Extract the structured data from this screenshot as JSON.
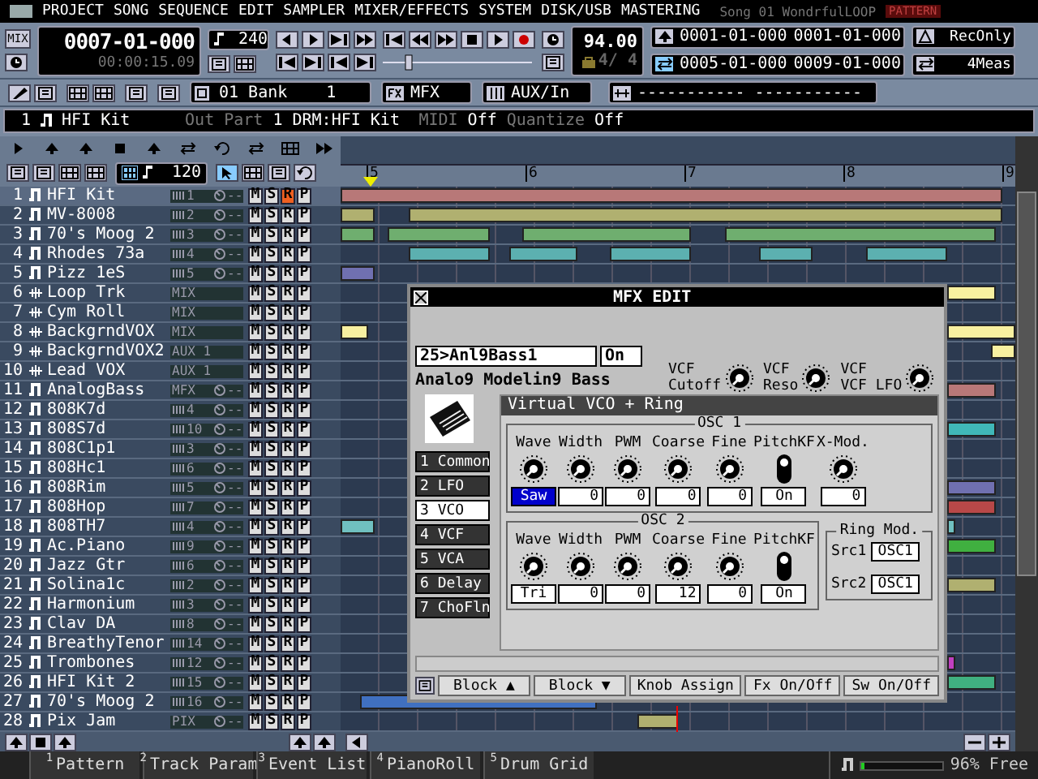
{
  "menu": {
    "items": [
      "PROJECT",
      "SONG",
      "SEQUENCE",
      "EDIT",
      "SAMPLER",
      "MIXER/EFFECTS",
      "SYSTEM",
      "DISK/USB",
      "MASTERING"
    ],
    "song_title": "Song 01 WondrfulLOOP",
    "mode_badge": "PATTERN"
  },
  "transport": {
    "mix_button": "MIX",
    "position": "0007-01-000",
    "time": "00:00:15.09",
    "step": "240",
    "tempo": "94.00",
    "meter": "4/ 4",
    "locate": [
      "0001-01-000",
      "0001-01-000"
    ],
    "loop": [
      "0005-01-000",
      "0009-01-000"
    ],
    "rec_mode": "RecOnly",
    "loop_length": "4Meas"
  },
  "mixer_row": {
    "bank": "01 Bank",
    "bank_number": "1",
    "mfx": "MFX",
    "aux": "AUX/In",
    "marker": "----------- -----------"
  },
  "info": {
    "track": "1",
    "part": "HFI Kit",
    "out_label": "Out Part",
    "out_value": "1 DRM:HFI Kit",
    "midi_label": "MIDI",
    "midi_value": "Off",
    "quantize_label": "Quantize",
    "quantize_value": "Off"
  },
  "toolbar": {
    "resolution": "120"
  },
  "ruler": {
    "bars": [
      "5",
      "6",
      "7",
      "8",
      "9"
    ]
  },
  "tracks": [
    {
      "number": "1",
      "kind": "midi",
      "name": "HFI Kit",
      "output": "1",
      "port": true,
      "pan": "--",
      "mute": "M",
      "solo": "S",
      "rec": "R",
      "play": "P",
      "record": true,
      "selected": true,
      "color": "#b87878"
    },
    {
      "number": "2",
      "kind": "midi",
      "name": "MV-8008",
      "output": "2",
      "port": true,
      "pan": "--",
      "mute": "M",
      "solo": "S",
      "rec": "R",
      "play": "P",
      "record": false,
      "selected": false,
      "color": "#b0b070"
    },
    {
      "number": "3",
      "kind": "midi",
      "name": "70's Moog 2",
      "output": "3",
      "port": true,
      "pan": "--",
      "mute": "M",
      "solo": "S",
      "rec": "R",
      "play": "P",
      "record": false,
      "selected": false,
      "color": "#6fae6f"
    },
    {
      "number": "4",
      "kind": "midi",
      "name": "Rhodes 73a",
      "output": "4",
      "port": true,
      "pan": "--",
      "mute": "M",
      "solo": "S",
      "rec": "R",
      "play": "P",
      "record": false,
      "selected": false,
      "color": "#5cb0b0"
    },
    {
      "number": "5",
      "kind": "midi",
      "name": "Pizz 1eS",
      "output": "5",
      "port": true,
      "pan": "--",
      "mute": "M",
      "solo": "S",
      "rec": "R",
      "play": "P",
      "record": false,
      "selected": false,
      "color": "#7070b0"
    },
    {
      "number": "6",
      "kind": "audio",
      "name": "Loop Trk",
      "output": "MIX",
      "port": false,
      "mute": "M",
      "solo": "S",
      "rec": "R",
      "play": "P",
      "record": false,
      "selected": false,
      "color": "#f8f0a0"
    },
    {
      "number": "7",
      "kind": "audio",
      "name": "Cym Roll",
      "output": "MIX",
      "port": false,
      "mute": "M",
      "solo": "S",
      "rec": "R",
      "play": "P",
      "record": false,
      "selected": false
    },
    {
      "number": "8",
      "kind": "audio",
      "name": "BackgrndVOX",
      "output": "MIX",
      "port": false,
      "mute": "M",
      "solo": "S",
      "rec": "R",
      "play": "P",
      "record": false,
      "selected": false,
      "color": "#f8f0a0"
    },
    {
      "number": "9",
      "kind": "audio",
      "name": "BackgrndVOX2",
      "output": "AUX 1",
      "port": false,
      "mute": "M",
      "solo": "S",
      "rec": "R",
      "play": "P",
      "record": false,
      "selected": false,
      "color": "#f8f0a0"
    },
    {
      "number": "10",
      "kind": "audio",
      "name": "Lead VOX",
      "output": "AUX 1",
      "port": false,
      "mute": "M",
      "solo": "S",
      "rec": "R",
      "play": "P",
      "record": false,
      "selected": false
    },
    {
      "number": "11",
      "kind": "midi",
      "name": "AnalogBass",
      "output": "MFX",
      "port": false,
      "pan": "--",
      "mute": "M",
      "solo": "S",
      "rec": "R",
      "play": "P",
      "record": false,
      "selected": false,
      "color": "#b87878"
    },
    {
      "number": "12",
      "kind": "midi",
      "name": "808K7d",
      "output": "4",
      "port": true,
      "pan": "--",
      "mute": "M",
      "solo": "S",
      "rec": "R",
      "play": "P",
      "record": false,
      "selected": false
    },
    {
      "number": "13",
      "kind": "midi",
      "name": "808S7d",
      "output": "10",
      "port": true,
      "pan": "--",
      "mute": "M",
      "solo": "S",
      "rec": "R",
      "play": "P",
      "record": false,
      "selected": false,
      "color": "#40b8b8"
    },
    {
      "number": "14",
      "kind": "midi",
      "name": "808C1p1",
      "output": "3",
      "port": true,
      "pan": "--",
      "mute": "M",
      "solo": "S",
      "rec": "R",
      "play": "P",
      "record": false,
      "selected": false
    },
    {
      "number": "15",
      "kind": "midi",
      "name": "808Hc1",
      "output": "6",
      "port": true,
      "pan": "--",
      "mute": "M",
      "solo": "S",
      "rec": "R",
      "play": "P",
      "record": false,
      "selected": false
    },
    {
      "number": "16",
      "kind": "midi",
      "name": "808Rim",
      "output": "5",
      "port": true,
      "pan": "--",
      "mute": "M",
      "solo": "S",
      "rec": "R",
      "play": "P",
      "record": false,
      "selected": false,
      "color": "#7070b0"
    },
    {
      "number": "17",
      "kind": "midi",
      "name": "808Hop",
      "output": "7",
      "port": true,
      "pan": "--",
      "mute": "M",
      "solo": "S",
      "rec": "R",
      "play": "P",
      "record": false,
      "selected": false,
      "color": "#b84848"
    },
    {
      "number": "18",
      "kind": "midi",
      "name": "808TH7",
      "output": "4",
      "port": true,
      "pan": "--",
      "mute": "M",
      "solo": "S",
      "rec": "R",
      "play": "P",
      "record": false,
      "selected": false,
      "color": "#70c0c0"
    },
    {
      "number": "19",
      "kind": "midi",
      "name": "Ac.Piano",
      "output": "9",
      "port": true,
      "pan": "--",
      "mute": "M",
      "solo": "S",
      "rec": "R",
      "play": "P",
      "record": false,
      "selected": false,
      "color": "#40b040"
    },
    {
      "number": "20",
      "kind": "midi",
      "name": "Jazz Gtr",
      "output": "6",
      "port": true,
      "pan": "--",
      "mute": "M",
      "solo": "S",
      "rec": "R",
      "play": "P",
      "record": false,
      "selected": false
    },
    {
      "number": "21",
      "kind": "midi",
      "name": "Solina1c",
      "output": "2",
      "port": true,
      "pan": "--",
      "mute": "M",
      "solo": "S",
      "rec": "R",
      "play": "P",
      "record": false,
      "selected": false,
      "color": "#b0b070"
    },
    {
      "number": "22",
      "kind": "midi",
      "name": "Harmonium",
      "output": "3",
      "port": true,
      "pan": "--",
      "mute": "M",
      "solo": "S",
      "rec": "R",
      "play": "P",
      "record": false,
      "selected": false
    },
    {
      "number": "23",
      "kind": "midi",
      "name": "Clav DA",
      "output": "8",
      "port": true,
      "pan": "--",
      "mute": "M",
      "solo": "S",
      "rec": "R",
      "play": "P",
      "record": false,
      "selected": false
    },
    {
      "number": "24",
      "kind": "midi",
      "name": "BreathyTenor",
      "output": "14",
      "port": true,
      "pan": "--",
      "mute": "M",
      "solo": "S",
      "rec": "R",
      "play": "P",
      "record": false,
      "selected": false
    },
    {
      "number": "25",
      "kind": "midi",
      "name": "Trombones",
      "output": "12",
      "port": true,
      "pan": "--",
      "mute": "M",
      "solo": "S",
      "rec": "R",
      "play": "P",
      "record": false,
      "selected": false,
      "color": "#c040c0"
    },
    {
      "number": "26",
      "kind": "midi",
      "name": "HFI Kit 2",
      "output": "15",
      "port": true,
      "pan": "--",
      "mute": "M",
      "solo": "S",
      "rec": "R",
      "play": "P",
      "record": false,
      "selected": false,
      "color": "#40b080"
    },
    {
      "number": "27",
      "kind": "midi",
      "name": "70's Moog 2",
      "output": "16",
      "port": true,
      "pan": "--",
      "mute": "M",
      "solo": "S",
      "rec": "R",
      "play": "P",
      "record": false,
      "selected": false,
      "color": "#4070c0"
    },
    {
      "number": "28",
      "kind": "midi",
      "name": "Pix Jam",
      "output": "PIX",
      "port": false,
      "pan": "--",
      "mute": "M",
      "solo": "S",
      "rec": "R",
      "play": "P",
      "record": false,
      "selected": false,
      "color": "#b0b070"
    }
  ],
  "mfx_edit": {
    "title": "MFX EDIT",
    "preset": "25>Anl9Bass1",
    "switch": "On",
    "preset_name": "Analo9 Modelin9 Bass",
    "quick_knobs": [
      {
        "line_1": "VCF",
        "line_2": "Cutoff"
      },
      {
        "line_1": "VCF",
        "line_2": "Reso"
      },
      {
        "line_1": "VCF",
        "line_2": "VCF LFO"
      }
    ],
    "pages": [
      {
        "label": "1 Common",
        "selected": false
      },
      {
        "label": "2 LFO",
        "selected": false
      },
      {
        "label": "3 VCO",
        "selected": true
      },
      {
        "label": "4 VCF",
        "selected": false
      },
      {
        "label": "5 VCA",
        "selected": false
      },
      {
        "label": "6 Delay",
        "selected": false
      },
      {
        "label": "7 ChoFln",
        "selected": false
      }
    ],
    "panel_title": "Virtual VCO + Ring",
    "oscillators": [
      {
        "title": "OSC 1",
        "params": [
          {
            "label": "Wave",
            "kind": "knob",
            "value": "Saw",
            "selected": true
          },
          {
            "label": "Width",
            "kind": "knob",
            "value": "0",
            "selected": false
          },
          {
            "label": "PWM",
            "kind": "knob",
            "value": "0",
            "selected": false
          },
          {
            "label": "Coarse",
            "kind": "knob",
            "value": "0",
            "selected": false
          },
          {
            "label": "Fine",
            "kind": "knob",
            "value": "0",
            "selected": false
          },
          {
            "label": "PitchKF",
            "kind": "switch",
            "value": "On",
            "on": true,
            "selected": false
          },
          {
            "label": "X-Mod.",
            "kind": "knob",
            "value": "0",
            "selected": false
          }
        ]
      },
      {
        "title": "OSC 2",
        "params": [
          {
            "label": "Wave",
            "kind": "knob",
            "value": "Tri",
            "selected": false
          },
          {
            "label": "Width",
            "kind": "knob",
            "value": "0",
            "selected": false
          },
          {
            "label": "PWM",
            "kind": "knob",
            "value": "0",
            "selected": false
          },
          {
            "label": "Coarse",
            "kind": "knob",
            "value": "12",
            "selected": false
          },
          {
            "label": "Fine",
            "kind": "knob",
            "value": "0",
            "selected": false
          },
          {
            "label": "PitchKF",
            "kind": "switch",
            "value": "On",
            "on": true,
            "selected": false
          }
        ]
      }
    ],
    "ring_mod": {
      "title": "Ring Mod.",
      "sources": [
        {
          "label": "Src1",
          "value": "OSC1"
        },
        {
          "label": "Src2",
          "value": "OSC1"
        }
      ]
    },
    "buttons": [
      "Block ▲",
      "Block ▼",
      "Knob Assign",
      "Fx On/Off",
      "Sw On/Off"
    ]
  },
  "bottom_tabs": [
    {
      "number": "1",
      "label": "Pattern"
    },
    {
      "number": "2",
      "label": "Track Param"
    },
    {
      "number": "3",
      "label": "Event List"
    },
    {
      "number": "4",
      "label": "PianoRoll"
    },
    {
      "number": "5",
      "label": "Drum Grid"
    }
  ],
  "memory": {
    "level": 0.05,
    "text": "96% Free"
  }
}
